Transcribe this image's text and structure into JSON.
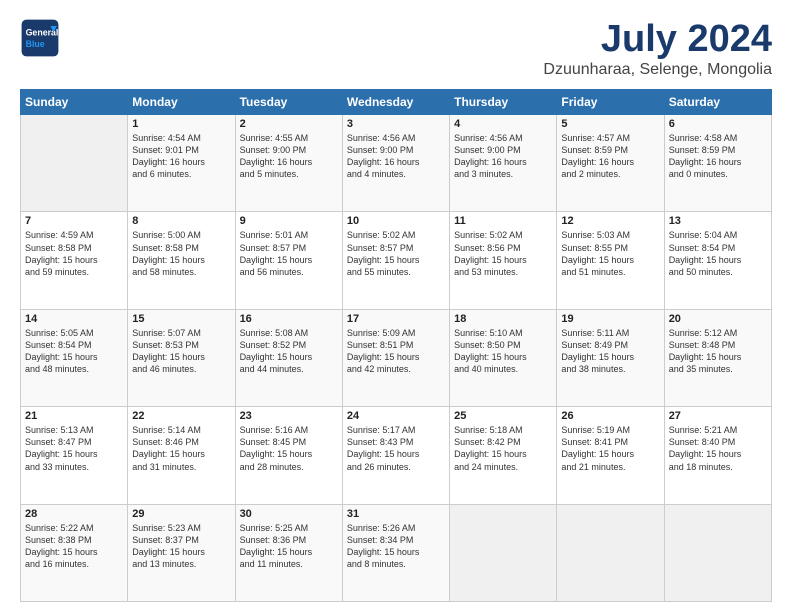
{
  "header": {
    "logo_general": "General",
    "logo_blue": "Blue",
    "main_title": "July 2024",
    "subtitle": "Dzuunharaa, Selenge, Mongolia"
  },
  "calendar": {
    "days_of_week": [
      "Sunday",
      "Monday",
      "Tuesday",
      "Wednesday",
      "Thursday",
      "Friday",
      "Saturday"
    ],
    "weeks": [
      [
        {
          "day": "",
          "info": ""
        },
        {
          "day": "1",
          "info": "Sunrise: 4:54 AM\nSunset: 9:01 PM\nDaylight: 16 hours\nand 6 minutes."
        },
        {
          "day": "2",
          "info": "Sunrise: 4:55 AM\nSunset: 9:00 PM\nDaylight: 16 hours\nand 5 minutes."
        },
        {
          "day": "3",
          "info": "Sunrise: 4:56 AM\nSunset: 9:00 PM\nDaylight: 16 hours\nand 4 minutes."
        },
        {
          "day": "4",
          "info": "Sunrise: 4:56 AM\nSunset: 9:00 PM\nDaylight: 16 hours\nand 3 minutes."
        },
        {
          "day": "5",
          "info": "Sunrise: 4:57 AM\nSunset: 8:59 PM\nDaylight: 16 hours\nand 2 minutes."
        },
        {
          "day": "6",
          "info": "Sunrise: 4:58 AM\nSunset: 8:59 PM\nDaylight: 16 hours\nand 0 minutes."
        }
      ],
      [
        {
          "day": "7",
          "info": "Sunrise: 4:59 AM\nSunset: 8:58 PM\nDaylight: 15 hours\nand 59 minutes."
        },
        {
          "day": "8",
          "info": "Sunrise: 5:00 AM\nSunset: 8:58 PM\nDaylight: 15 hours\nand 58 minutes."
        },
        {
          "day": "9",
          "info": "Sunrise: 5:01 AM\nSunset: 8:57 PM\nDaylight: 15 hours\nand 56 minutes."
        },
        {
          "day": "10",
          "info": "Sunrise: 5:02 AM\nSunset: 8:57 PM\nDaylight: 15 hours\nand 55 minutes."
        },
        {
          "day": "11",
          "info": "Sunrise: 5:02 AM\nSunset: 8:56 PM\nDaylight: 15 hours\nand 53 minutes."
        },
        {
          "day": "12",
          "info": "Sunrise: 5:03 AM\nSunset: 8:55 PM\nDaylight: 15 hours\nand 51 minutes."
        },
        {
          "day": "13",
          "info": "Sunrise: 5:04 AM\nSunset: 8:54 PM\nDaylight: 15 hours\nand 50 minutes."
        }
      ],
      [
        {
          "day": "14",
          "info": "Sunrise: 5:05 AM\nSunset: 8:54 PM\nDaylight: 15 hours\nand 48 minutes."
        },
        {
          "day": "15",
          "info": "Sunrise: 5:07 AM\nSunset: 8:53 PM\nDaylight: 15 hours\nand 46 minutes."
        },
        {
          "day": "16",
          "info": "Sunrise: 5:08 AM\nSunset: 8:52 PM\nDaylight: 15 hours\nand 44 minutes."
        },
        {
          "day": "17",
          "info": "Sunrise: 5:09 AM\nSunset: 8:51 PM\nDaylight: 15 hours\nand 42 minutes."
        },
        {
          "day": "18",
          "info": "Sunrise: 5:10 AM\nSunset: 8:50 PM\nDaylight: 15 hours\nand 40 minutes."
        },
        {
          "day": "19",
          "info": "Sunrise: 5:11 AM\nSunset: 8:49 PM\nDaylight: 15 hours\nand 38 minutes."
        },
        {
          "day": "20",
          "info": "Sunrise: 5:12 AM\nSunset: 8:48 PM\nDaylight: 15 hours\nand 35 minutes."
        }
      ],
      [
        {
          "day": "21",
          "info": "Sunrise: 5:13 AM\nSunset: 8:47 PM\nDaylight: 15 hours\nand 33 minutes."
        },
        {
          "day": "22",
          "info": "Sunrise: 5:14 AM\nSunset: 8:46 PM\nDaylight: 15 hours\nand 31 minutes."
        },
        {
          "day": "23",
          "info": "Sunrise: 5:16 AM\nSunset: 8:45 PM\nDaylight: 15 hours\nand 28 minutes."
        },
        {
          "day": "24",
          "info": "Sunrise: 5:17 AM\nSunset: 8:43 PM\nDaylight: 15 hours\nand 26 minutes."
        },
        {
          "day": "25",
          "info": "Sunrise: 5:18 AM\nSunset: 8:42 PM\nDaylight: 15 hours\nand 24 minutes."
        },
        {
          "day": "26",
          "info": "Sunrise: 5:19 AM\nSunset: 8:41 PM\nDaylight: 15 hours\nand 21 minutes."
        },
        {
          "day": "27",
          "info": "Sunrise: 5:21 AM\nSunset: 8:40 PM\nDaylight: 15 hours\nand 18 minutes."
        }
      ],
      [
        {
          "day": "28",
          "info": "Sunrise: 5:22 AM\nSunset: 8:38 PM\nDaylight: 15 hours\nand 16 minutes."
        },
        {
          "day": "29",
          "info": "Sunrise: 5:23 AM\nSunset: 8:37 PM\nDaylight: 15 hours\nand 13 minutes."
        },
        {
          "day": "30",
          "info": "Sunrise: 5:25 AM\nSunset: 8:36 PM\nDaylight: 15 hours\nand 11 minutes."
        },
        {
          "day": "31",
          "info": "Sunrise: 5:26 AM\nSunset: 8:34 PM\nDaylight: 15 hours\nand 8 minutes."
        },
        {
          "day": "",
          "info": ""
        },
        {
          "day": "",
          "info": ""
        },
        {
          "day": "",
          "info": ""
        }
      ]
    ]
  }
}
